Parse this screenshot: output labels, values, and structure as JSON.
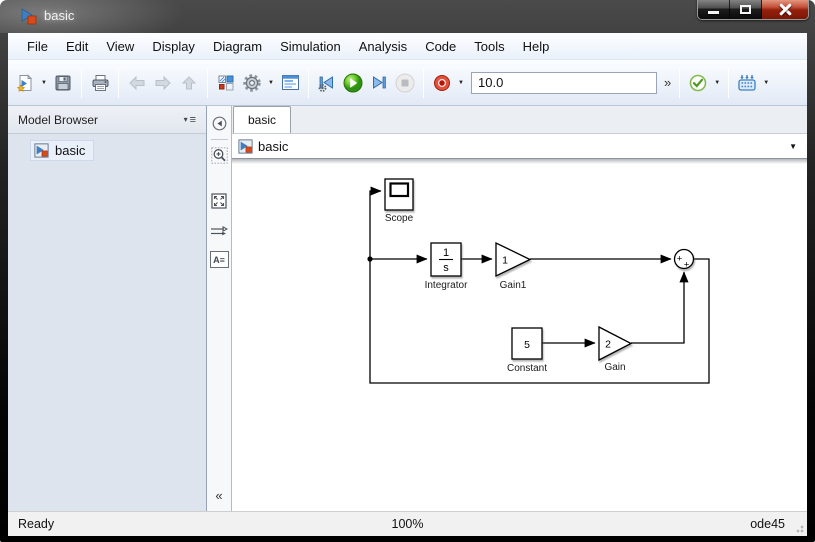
{
  "window": {
    "title": "basic"
  },
  "menu": {
    "items": [
      "File",
      "Edit",
      "View",
      "Display",
      "Diagram",
      "Simulation",
      "Analysis",
      "Code",
      "Tools",
      "Help"
    ]
  },
  "toolbar": {
    "sim_time": "10.0",
    "overflow_chevron": "»",
    "icon_names": [
      "new-model",
      "save",
      "print",
      "back",
      "forward",
      "up",
      "library-browser",
      "model-configuration",
      "model-explorer",
      "step-back",
      "run",
      "step-forward",
      "stop",
      "record",
      "simulation-time",
      "show-more",
      "model-advisor",
      "fast-restart"
    ]
  },
  "model_browser": {
    "title": "Model Browser",
    "items": [
      {
        "label": "basic"
      }
    ]
  },
  "tabs": [
    {
      "label": "basic"
    }
  ],
  "breadcrumb": {
    "label": "basic"
  },
  "palette": {
    "icon_names": [
      "hide-browser",
      "zoom-in",
      "fit-to-view",
      "signal-lines",
      "annotation",
      "collapse"
    ]
  },
  "glyphs": {
    "dropdown": "▼",
    "panel_menu_arrow": "▾",
    "panel_menu_lines": "≡",
    "collapse": "«",
    "annotation_a": "A",
    "annotation_lines": "≡"
  },
  "diagram": {
    "scope_label": "Scope",
    "integrator_label": "Integrator",
    "integrator_num": "1",
    "integrator_den": "s",
    "gain1_label": "Gain1",
    "gain1_value": "1",
    "constant_label": "Constant",
    "constant_value": "5",
    "gain_label": "Gain",
    "gain_value": "2",
    "sum_sign_left": "+",
    "sum_sign_bottom": "+"
  },
  "status": {
    "left": "Ready",
    "zoom": "100%",
    "solver": "ode45"
  }
}
